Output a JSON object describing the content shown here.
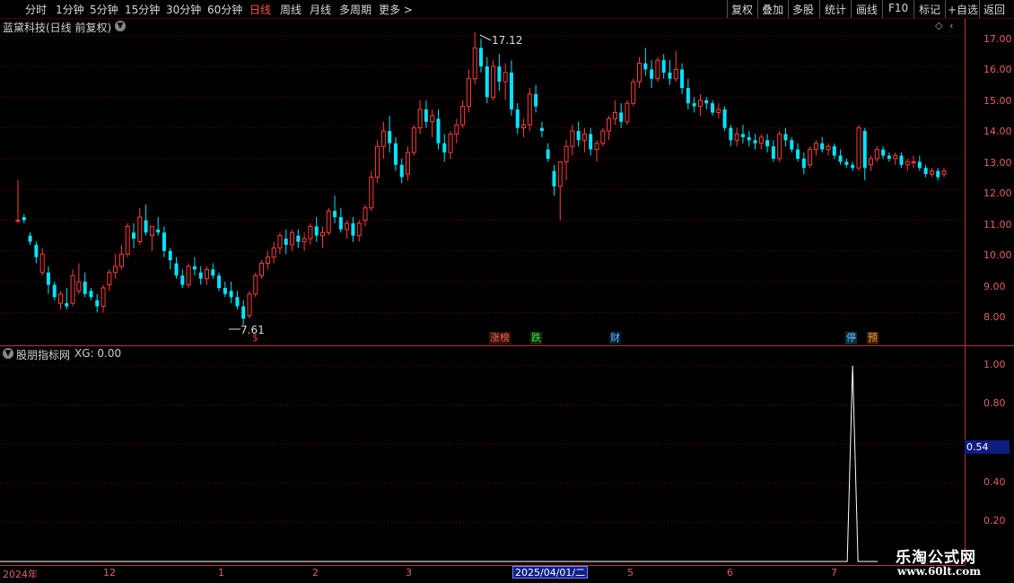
{
  "toolbar": {
    "periods": [
      "分时",
      "1分钟",
      "5分钟",
      "15分钟",
      "30分钟",
      "60分钟",
      "日线",
      "周线",
      "月线",
      "多周期",
      "更多 >"
    ],
    "active_period": "日线",
    "actions": [
      "复权",
      "叠加",
      "多股",
      "统计",
      "画线",
      "F10",
      "标记",
      "+自选",
      "返回"
    ]
  },
  "main_chart": {
    "title": "蓝黛科技(日线 前复权)",
    "high_label": "17.12",
    "low_label": "7.61",
    "y_ticks": [
      "17.00",
      "16.00",
      "15.00",
      "14.00",
      "13.00",
      "12.00",
      "11.00",
      "10.00",
      "9.00",
      "8.00"
    ],
    "events": [
      {
        "label": "$",
        "color": "#ff3030",
        "bg": "#000"
      },
      {
        "label": "涨榜",
        "color": "#ff6060",
        "bg": "#2a1200"
      },
      {
        "label": "跌",
        "color": "#40e040",
        "bg": "#102a10"
      },
      {
        "label": "财",
        "color": "#60c0ff",
        "bg": "#001830"
      },
      {
        "label": "停",
        "color": "#60c0ff",
        "bg": "#00303a"
      },
      {
        "label": "预",
        "color": "#ffa040",
        "bg": "#3a2000"
      }
    ]
  },
  "indicator": {
    "title": "股朋指标网",
    "value_label": "XG: 0.00",
    "y_ticks": [
      "1.00",
      "0.80",
      "0.40",
      "0.20"
    ],
    "selected_value": "0.54"
  },
  "x_axis": {
    "labels": [
      "2024年",
      "12",
      "1",
      "2",
      "3",
      "5",
      "6",
      "7"
    ],
    "selected_date": "2025/04/01/二"
  },
  "watermark": {
    "name": "乐淘公式网",
    "url": "www.60lt.com"
  },
  "colors": {
    "up": "#ff3b3b",
    "down": "#00e5ff",
    "axis": "#c03030",
    "grid": "#7a0000",
    "bg": "#000000"
  },
  "chart_data": {
    "type": "candlestick",
    "ylim": [
      7.4,
      17.4
    ],
    "indicator_ylim": [
      0,
      1.1
    ],
    "bars": [
      [
        11.0,
        12.3,
        10.9,
        11.0
      ],
      [
        11.1,
        11.2,
        10.9,
        11.0
      ],
      [
        10.5,
        10.6,
        10.2,
        10.3
      ],
      [
        10.2,
        10.3,
        9.6,
        9.8
      ],
      [
        9.3,
        10.1,
        9.2,
        9.9
      ],
      [
        9.3,
        9.5,
        8.6,
        8.9
      ],
      [
        8.9,
        9.0,
        8.4,
        8.5
      ],
      [
        8.3,
        8.7,
        8.1,
        8.6
      ],
      [
        8.3,
        8.8,
        8.1,
        8.2
      ],
      [
        8.3,
        9.4,
        8.2,
        9.2
      ],
      [
        8.7,
        9.6,
        8.6,
        9.0
      ],
      [
        9.0,
        9.3,
        8.5,
        8.6
      ],
      [
        8.7,
        8.8,
        8.4,
        8.5
      ],
      [
        8.4,
        8.6,
        8.0,
        8.2
      ],
      [
        8.2,
        8.9,
        8.0,
        8.8
      ],
      [
        8.9,
        9.4,
        8.7,
        9.3
      ],
      [
        9.3,
        9.9,
        9.1,
        9.5
      ],
      [
        9.5,
        10.2,
        9.4,
        9.9
      ],
      [
        9.9,
        10.9,
        9.8,
        10.8
      ],
      [
        10.6,
        10.9,
        10.1,
        10.4
      ],
      [
        10.3,
        11.4,
        10.2,
        11.1
      ],
      [
        11.0,
        11.5,
        10.5,
        10.6
      ],
      [
        10.5,
        10.8,
        10.0,
        10.8
      ],
      [
        10.7,
        11.1,
        10.5,
        10.6
      ],
      [
        10.6,
        10.8,
        9.8,
        10.0
      ],
      [
        10.0,
        10.1,
        9.4,
        9.7
      ],
      [
        9.6,
        9.8,
        9.1,
        9.2
      ],
      [
        9.2,
        9.4,
        8.8,
        8.9
      ],
      [
        8.9,
        9.6,
        8.8,
        9.5
      ],
      [
        9.5,
        9.8,
        9.2,
        9.4
      ],
      [
        9.3,
        9.5,
        8.9,
        9.1
      ],
      [
        9.1,
        9.5,
        8.9,
        9.4
      ],
      [
        9.4,
        9.6,
        9.1,
        9.2
      ],
      [
        9.2,
        9.3,
        8.7,
        8.8
      ],
      [
        8.8,
        9.0,
        8.5,
        8.6
      ],
      [
        8.7,
        9.0,
        8.3,
        8.5
      ],
      [
        8.5,
        8.7,
        8.1,
        8.2
      ],
      [
        8.2,
        8.4,
        7.6,
        7.8
      ],
      [
        7.9,
        8.7,
        7.8,
        8.6
      ],
      [
        8.6,
        9.3,
        8.5,
        9.2
      ],
      [
        9.2,
        9.7,
        9.1,
        9.6
      ],
      [
        9.6,
        10.0,
        9.4,
        9.8
      ],
      [
        9.8,
        10.3,
        9.6,
        10.1
      ],
      [
        10.1,
        10.6,
        9.9,
        10.5
      ],
      [
        10.4,
        10.7,
        9.9,
        10.2
      ],
      [
        10.2,
        10.7,
        10.0,
        10.6
      ],
      [
        10.5,
        10.7,
        10.1,
        10.3
      ],
      [
        10.3,
        10.6,
        10.0,
        10.4
      ],
      [
        10.4,
        10.9,
        10.2,
        10.8
      ],
      [
        10.8,
        11.1,
        10.3,
        10.5
      ],
      [
        10.5,
        10.8,
        10.1,
        10.6
      ],
      [
        10.6,
        11.4,
        10.5,
        11.3
      ],
      [
        11.3,
        11.8,
        10.9,
        11.1
      ],
      [
        11.1,
        11.4,
        10.6,
        10.7
      ],
      [
        10.7,
        11.0,
        10.4,
        10.9
      ],
      [
        10.9,
        11.1,
        10.3,
        10.5
      ],
      [
        10.5,
        11.0,
        10.3,
        10.9
      ],
      [
        11.0,
        11.5,
        10.8,
        11.4
      ],
      [
        11.4,
        12.6,
        11.3,
        12.4
      ],
      [
        12.4,
        13.6,
        12.2,
        13.4
      ],
      [
        13.4,
        14.2,
        13.0,
        13.9
      ],
      [
        13.9,
        14.4,
        13.2,
        13.5
      ],
      [
        13.5,
        13.7,
        12.6,
        12.8
      ],
      [
        12.8,
        13.0,
        12.2,
        12.4
      ],
      [
        12.5,
        13.4,
        12.3,
        13.2
      ],
      [
        13.2,
        14.1,
        13.1,
        14.0
      ],
      [
        14.0,
        14.9,
        13.8,
        14.6
      ],
      [
        14.6,
        14.9,
        14.0,
        14.2
      ],
      [
        14.2,
        14.6,
        13.7,
        14.4
      ],
      [
        14.3,
        14.6,
        13.3,
        13.5
      ],
      [
        13.5,
        13.8,
        12.9,
        13.2
      ],
      [
        13.2,
        13.9,
        13.0,
        13.8
      ],
      [
        13.8,
        14.3,
        13.5,
        14.1
      ],
      [
        14.1,
        14.9,
        14.0,
        14.7
      ],
      [
        14.7,
        15.9,
        14.5,
        15.6
      ],
      [
        15.6,
        17.1,
        15.4,
        16.6
      ],
      [
        16.6,
        16.9,
        15.8,
        16.0
      ],
      [
        16.0,
        16.3,
        14.8,
        15.0
      ],
      [
        15.0,
        16.2,
        14.9,
        16.0
      ],
      [
        16.0,
        16.4,
        15.2,
        15.5
      ],
      [
        15.5,
        16.1,
        14.9,
        15.8
      ],
      [
        15.8,
        16.2,
        14.4,
        14.6
      ],
      [
        14.6,
        14.8,
        13.8,
        14.0
      ],
      [
        14.0,
        14.3,
        13.7,
        14.1
      ],
      [
        14.1,
        15.3,
        13.9,
        15.1
      ],
      [
        15.1,
        15.4,
        14.5,
        14.7
      ],
      [
        14.0,
        14.2,
        13.7,
        13.9
      ],
      [
        13.3,
        13.5,
        12.9,
        13.0
      ],
      [
        12.6,
        12.8,
        11.8,
        12.1
      ],
      [
        12.1,
        12.5,
        11.0,
        12.9
      ],
      [
        12.9,
        13.6,
        12.3,
        13.4
      ],
      [
        13.4,
        14.1,
        13.1,
        13.9
      ],
      [
        13.9,
        14.2,
        13.4,
        13.6
      ],
      [
        13.6,
        14.0,
        13.2,
        13.8
      ],
      [
        13.8,
        14.0,
        13.1,
        13.3
      ],
      [
        13.3,
        13.6,
        12.9,
        13.5
      ],
      [
        13.5,
        14.0,
        13.4,
        13.9
      ],
      [
        13.9,
        14.4,
        13.6,
        14.3
      ],
      [
        14.3,
        14.9,
        14.1,
        14.5
      ],
      [
        14.5,
        14.8,
        14.0,
        14.2
      ],
      [
        14.2,
        14.9,
        14.1,
        14.8
      ],
      [
        14.8,
        15.6,
        14.7,
        15.5
      ],
      [
        15.5,
        16.3,
        15.3,
        16.1
      ],
      [
        16.1,
        16.6,
        15.7,
        15.9
      ],
      [
        15.9,
        16.2,
        15.3,
        15.6
      ],
      [
        15.6,
        16.3,
        15.5,
        16.2
      ],
      [
        16.2,
        16.4,
        15.6,
        15.8
      ],
      [
        15.8,
        16.2,
        15.4,
        15.6
      ],
      [
        15.6,
        16.5,
        15.5,
        15.9
      ],
      [
        15.9,
        16.1,
        15.1,
        15.3
      ],
      [
        15.3,
        15.6,
        14.6,
        14.8
      ],
      [
        14.8,
        15.0,
        14.5,
        14.7
      ],
      [
        14.7,
        15.1,
        14.4,
        14.9
      ],
      [
        14.9,
        15.0,
        14.6,
        14.8
      ],
      [
        14.8,
        14.9,
        14.4,
        14.5
      ],
      [
        14.5,
        14.8,
        14.3,
        14.6
      ],
      [
        14.6,
        14.7,
        13.9,
        14.0
      ],
      [
        14.0,
        14.1,
        13.4,
        13.6
      ],
      [
        13.6,
        14.0,
        13.4,
        13.8
      ],
      [
        13.8,
        14.1,
        13.5,
        13.7
      ],
      [
        13.7,
        13.9,
        13.4,
        13.6
      ],
      [
        13.6,
        13.8,
        13.3,
        13.5
      ],
      [
        13.5,
        13.8,
        13.3,
        13.7
      ],
      [
        13.6,
        13.8,
        13.2,
        13.4
      ],
      [
        13.4,
        13.6,
        12.9,
        13.0
      ],
      [
        13.0,
        13.9,
        12.9,
        13.8
      ],
      [
        13.8,
        14.0,
        13.4,
        13.6
      ],
      [
        13.6,
        13.7,
        13.2,
        13.3
      ],
      [
        13.3,
        13.5,
        12.9,
        13.0
      ],
      [
        13.0,
        13.2,
        12.5,
        12.7
      ],
      [
        12.8,
        13.4,
        12.7,
        13.3
      ],
      [
        13.3,
        13.6,
        13.1,
        13.5
      ],
      [
        13.5,
        13.7,
        13.2,
        13.3
      ],
      [
        13.3,
        13.5,
        13.1,
        13.4
      ],
      [
        13.4,
        13.5,
        13.0,
        13.1
      ],
      [
        13.1,
        13.3,
        12.8,
        12.9
      ],
      [
        12.9,
        13.0,
        12.7,
        12.8
      ],
      [
        12.8,
        12.9,
        12.6,
        12.7
      ],
      [
        12.7,
        14.1,
        12.6,
        14.0
      ],
      [
        13.9,
        14.0,
        12.3,
        12.7
      ],
      [
        12.8,
        13.1,
        12.6,
        13.0
      ],
      [
        13.0,
        13.4,
        12.9,
        13.3
      ],
      [
        13.3,
        13.4,
        13.0,
        13.1
      ],
      [
        13.1,
        13.2,
        12.9,
        13.0
      ],
      [
        13.0,
        13.2,
        12.8,
        13.1
      ],
      [
        13.1,
        13.2,
        12.7,
        12.8
      ],
      [
        12.8,
        13.0,
        12.6,
        12.9
      ],
      [
        12.9,
        13.1,
        12.7,
        12.9
      ],
      [
        12.9,
        13.1,
        12.6,
        12.7
      ],
      [
        12.7,
        12.8,
        12.4,
        12.5
      ],
      [
        12.5,
        12.7,
        12.4,
        12.6
      ],
      [
        12.6,
        12.7,
        12.3,
        12.4
      ],
      [
        12.5,
        12.7,
        12.4,
        12.6
      ]
    ],
    "xg_signal_index": 137,
    "xg_signal_value": 1.0
  }
}
